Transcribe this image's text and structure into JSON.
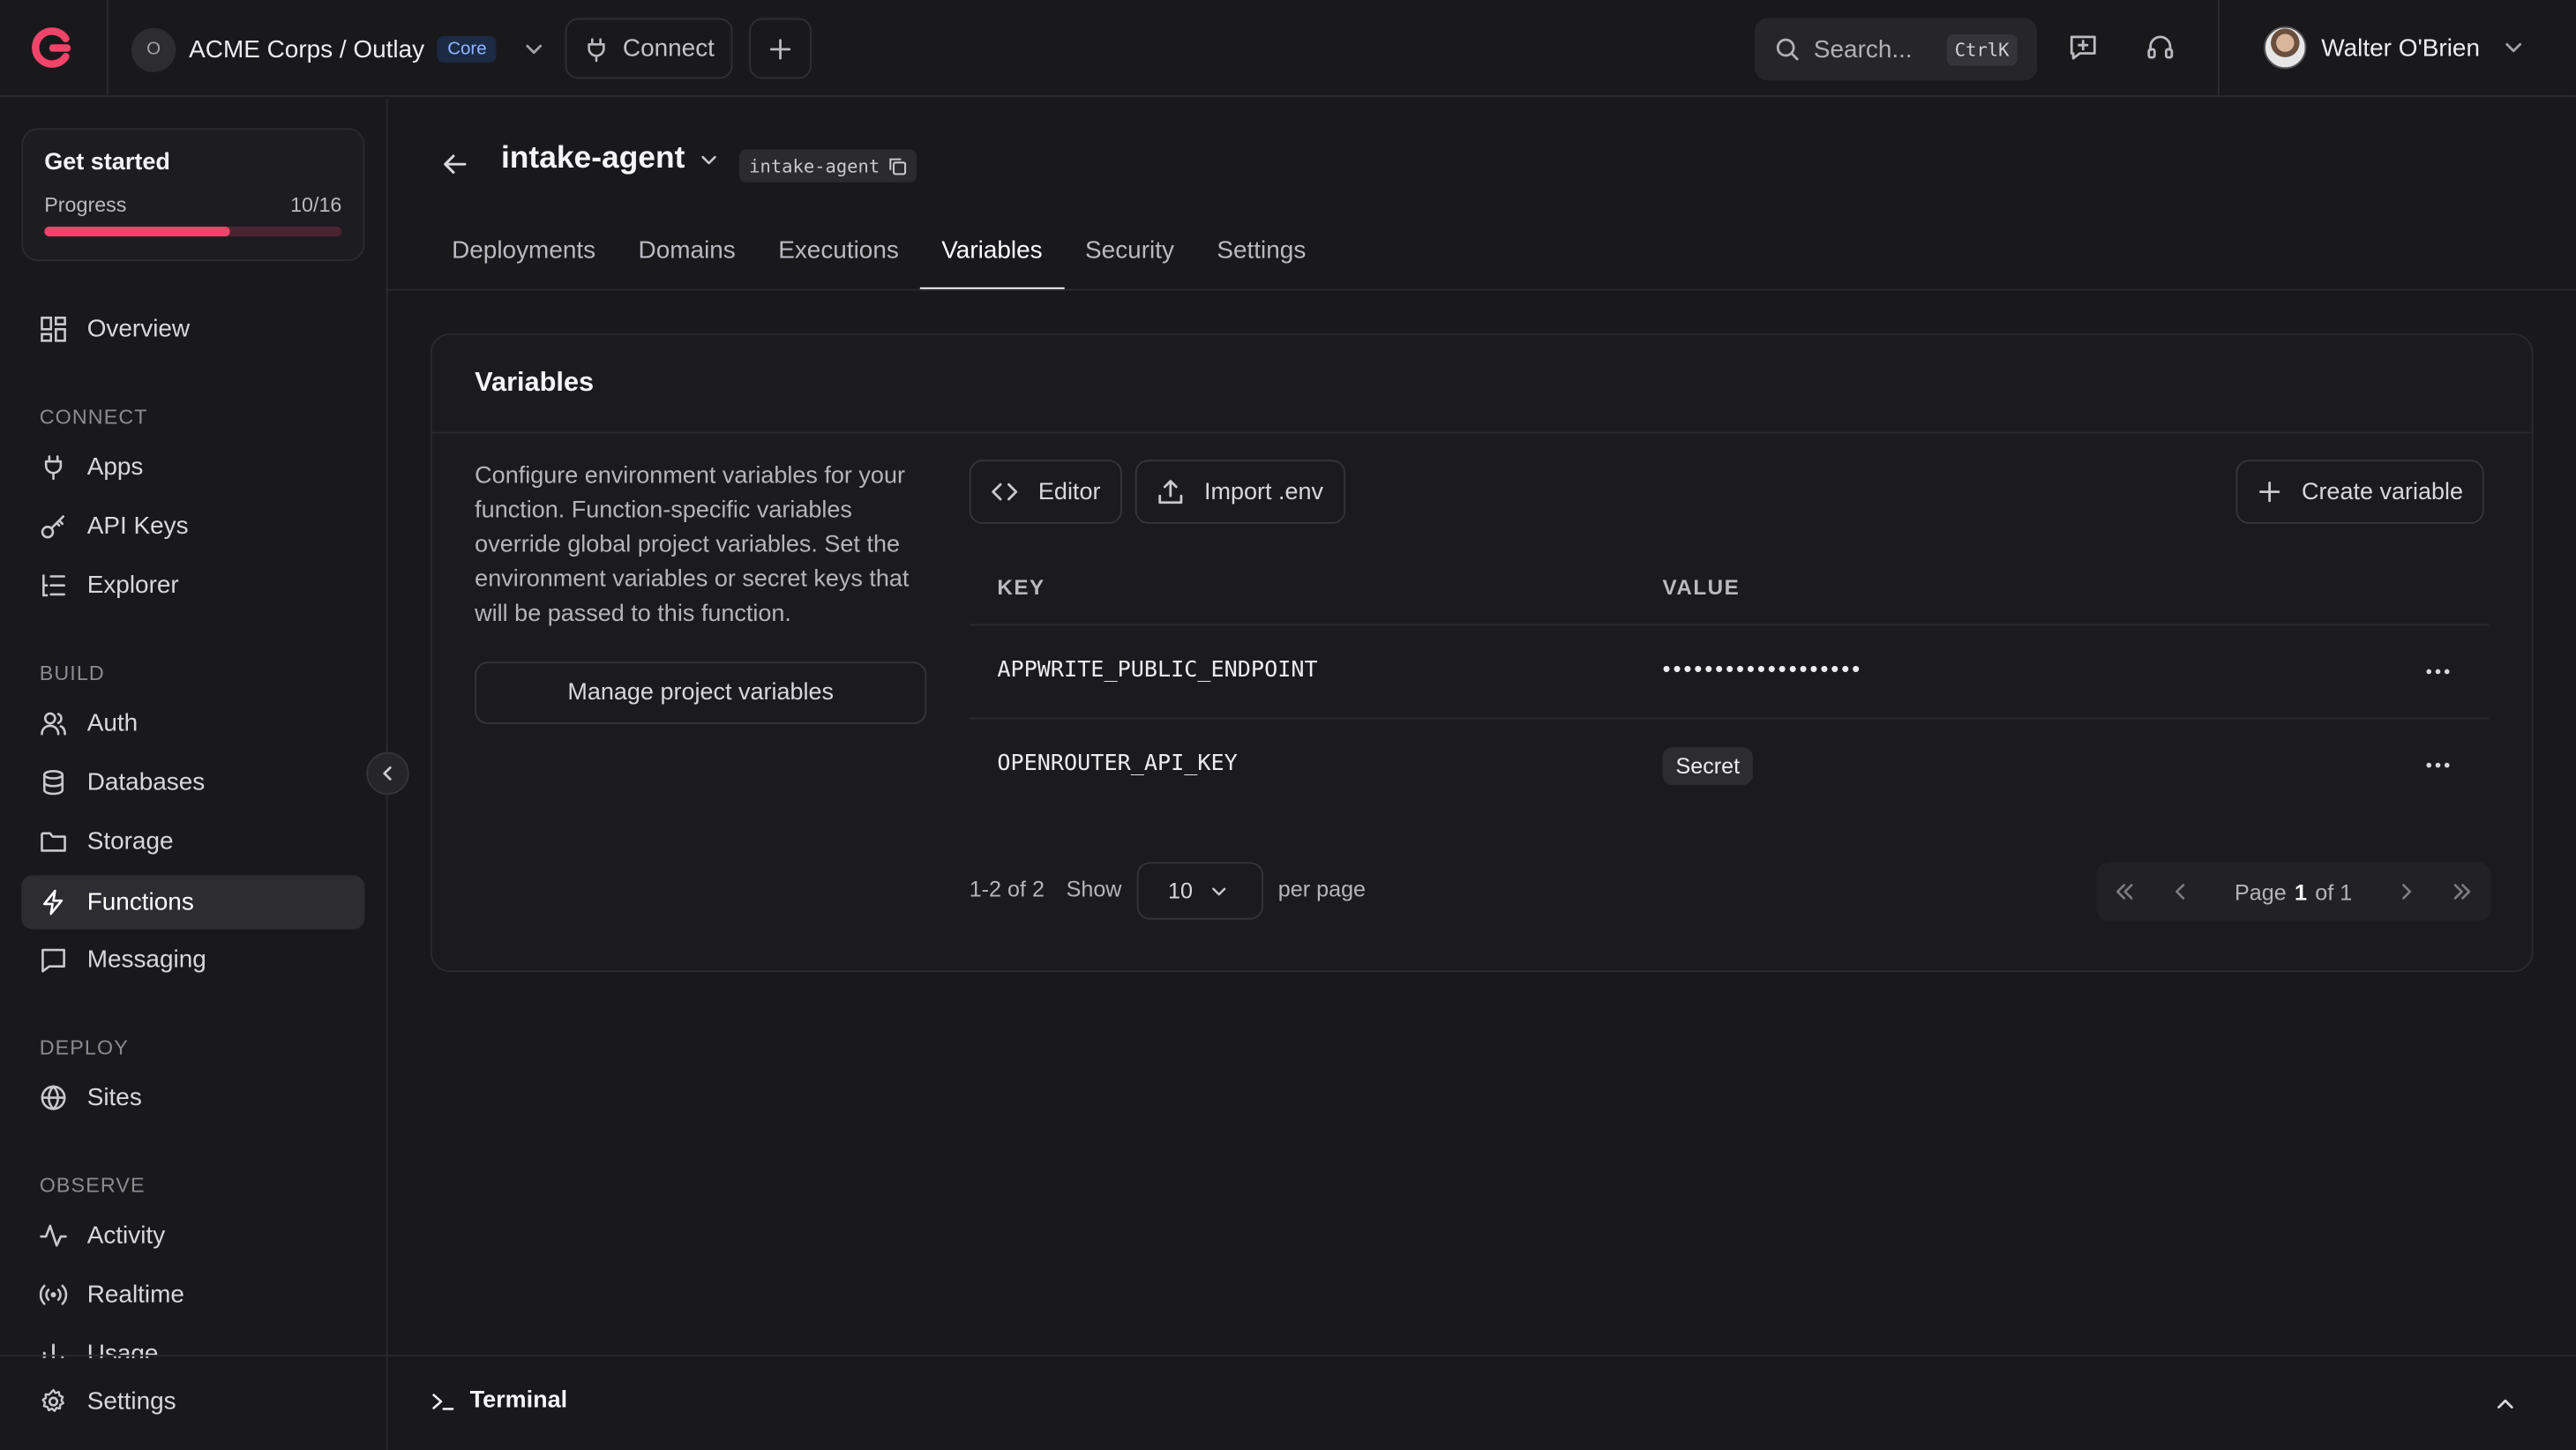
{
  "colors": {
    "background": "#19191c",
    "accent": "#f0446a",
    "border": "#2a2a2f"
  },
  "topbar": {
    "org_initial": "O",
    "org_name": "ACME Corps / Outlay",
    "plan_badge": "Core",
    "connect_label": "Connect",
    "search_placeholder": "Search...",
    "search_shortcut": "CtrlK",
    "user_name": "Walter O'Brien"
  },
  "sidebar": {
    "get_started": {
      "title": "Get started",
      "progress_label": "Progress",
      "progress_text": "10/16",
      "progress_value": 0.625
    },
    "overview": "Overview",
    "sections": {
      "connect": "CONNECT",
      "build": "BUILD",
      "deploy": "DEPLOY",
      "observe": "OBSERVE"
    },
    "items": {
      "apps": "Apps",
      "api_keys": "API Keys",
      "explorer": "Explorer",
      "auth": "Auth",
      "databases": "Databases",
      "storage": "Storage",
      "functions": "Functions",
      "messaging": "Messaging",
      "sites": "Sites",
      "activity": "Activity",
      "realtime": "Realtime",
      "usage": "Usage",
      "settings": "Settings"
    }
  },
  "function": {
    "name": "intake-agent",
    "id": "intake-agent"
  },
  "tabs": [
    "Deployments",
    "Domains",
    "Executions",
    "Variables",
    "Security",
    "Settings"
  ],
  "variables": {
    "title": "Variables",
    "description": "Configure environment variables for your function. Function-specific variables override global project variables. Set the environment variables or secret keys that will be passed to this function.",
    "manage_button": "Manage project variables",
    "editor_button": "Editor",
    "import_button": "Import .env",
    "create_button": "Create variable",
    "columns": {
      "key": "KEY",
      "value": "VALUE"
    },
    "rows": [
      {
        "key": "APPWRITE_PUBLIC_ENDPOINT",
        "value": "•••••••••••••••••••"
      },
      {
        "key": "OPENROUTER_API_KEY",
        "value": "Secret"
      }
    ],
    "pagination": {
      "range": "1-2 of 2",
      "show_label": "Show",
      "per_page_value": "10",
      "per_page_label": "per page",
      "page_label": "Page",
      "page_current": "1",
      "page_total": "of 1"
    }
  },
  "terminal": {
    "label": "Terminal"
  }
}
